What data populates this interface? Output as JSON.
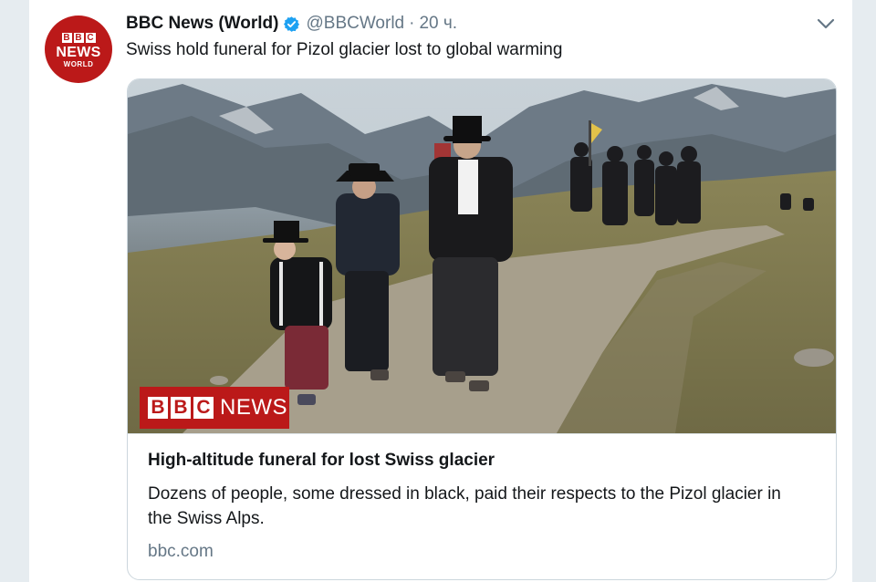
{
  "tweet": {
    "author_name": "BBC News (World)",
    "handle": "@BBCWorld",
    "separator": "·",
    "time": "20 ч.",
    "text": "Swiss hold funeral for Pizol glacier lost to global warming",
    "avatar": {
      "top": "BBC",
      "middle": "NEWS",
      "bottom": "WORLD",
      "color": "#bb1919"
    }
  },
  "card": {
    "image_logo": {
      "letters": [
        "B",
        "B",
        "C"
      ],
      "word": "NEWS"
    },
    "title": "High-altitude funeral for lost Swiss glacier",
    "description": "Dozens of people, some dressed in black, paid their respects to the Pizol glacier in the Swiss Alps.",
    "domain": "bbc.com"
  },
  "icons": {
    "verified": "verified-badge-icon",
    "more": "chevron-down-icon"
  },
  "colors": {
    "accent": "#1da1f2",
    "bbc_red": "#bb1919",
    "muted_text": "#657786"
  }
}
